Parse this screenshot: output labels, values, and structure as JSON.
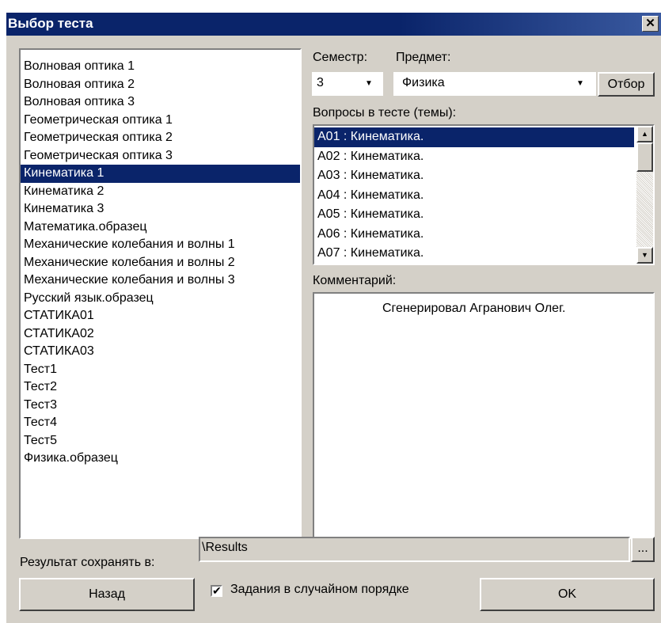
{
  "window": {
    "title": "Выбор теста",
    "close_glyph": "✕"
  },
  "tests": {
    "items": [
      "Волновая оптика 1",
      "Волновая оптика 2",
      "Волновая оптика 3",
      "Геометрическая оптика 1",
      "Геометрическая оптика 2",
      "Геометрическая оптика 3",
      "Кинематика 1",
      "Кинематика 2",
      "Кинематика 3",
      "Математика.образец",
      "Механические колебания и волны 1",
      "Механические колебания и волны 2",
      "Механические колебания и волны 3",
      "Русский язык.образец",
      "СТАТИКА01",
      "СТАТИКА02",
      "СТАТИКА03",
      "Тест1",
      "Тест2",
      "Тест3",
      "Тест4",
      "Тест5",
      "Физика.образец"
    ],
    "selected": "Кинематика 1"
  },
  "semester": {
    "label": "Семестр:",
    "value": "3"
  },
  "subject": {
    "label": "Предмет:",
    "value": "Физика"
  },
  "filter_button": "Отбор",
  "questions": {
    "label": "Вопросы в тесте (темы):",
    "items": [
      "A01 : Кинематика.",
      "A02 : Кинематика.",
      "A03 : Кинематика.",
      "A04 : Кинематика.",
      "A05 : Кинематика.",
      "A06 : Кинематика.",
      "A07 : Кинематика."
    ],
    "selected": "A01 : Кинематика."
  },
  "comment": {
    "label": "Комментарий:",
    "text": "Сгенерировал Агранович Олег."
  },
  "result": {
    "label": "Результат сохранять в:",
    "value": "\\Results",
    "browse": "..."
  },
  "back_button": "Назад",
  "random_order": {
    "label": "Задания в случайном порядке",
    "checked": true,
    "check_glyph": "✔"
  },
  "ok_button": "OK",
  "icons": {
    "dropdown": "▼",
    "scroll_up": "▲",
    "scroll_down": "▼"
  }
}
